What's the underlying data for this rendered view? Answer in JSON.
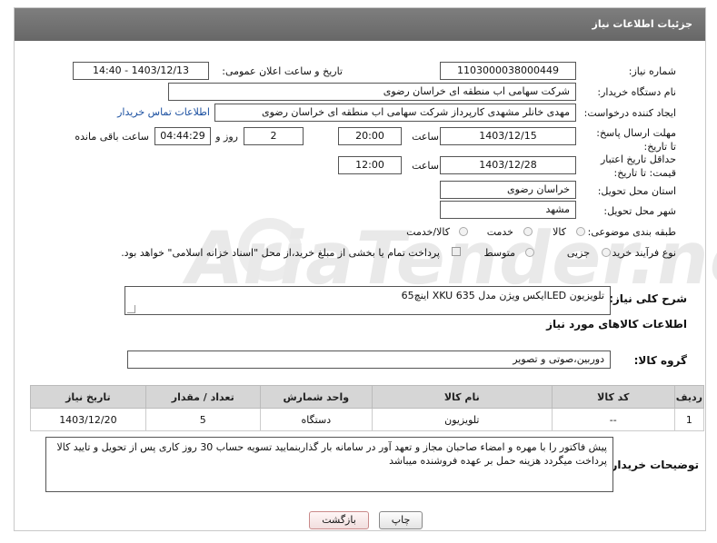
{
  "header": {
    "title": "جزئیات اطلاعات نیاز"
  },
  "labels": {
    "need_number": "شماره نیاز:",
    "announce_datetime": "تاریخ و ساعت اعلان عمومی:",
    "buyer_org": "نام دستگاه خریدار:",
    "requester": "ایجاد کننده درخواست:",
    "reply_deadline": "مهلت ارسال پاسخ: تا تاریخ:",
    "price_validity": "حداقل تاریخ اعتبار قیمت: تا تاریخ:",
    "time": "ساعت",
    "day_and": "روز و",
    "hours_remaining": "ساعت باقی مانده",
    "province": "استان محل تحویل:",
    "city": "شهر محل تحویل:",
    "category": "طبقه بندی موضوعی:",
    "process_type": "نوع فرآیند خرید :",
    "description": "شرح کلی نیاز:",
    "goods_info": "اطلاعات کالاهای مورد نیاز",
    "goods_group": "گروه کالا:",
    "buyer_notes": "توضیحات خریدار:"
  },
  "values": {
    "need_number": "1103000038000449",
    "announce_datetime": "1403/12/13 - 14:40",
    "buyer_org": "شرکت سهامی اب منطقه ای خراسان رضوی",
    "requester": "مهدی خانلر مشهدی کارپرداز شرکت سهامی اب منطقه ای خراسان رضوی",
    "contact_link": "اطلاعات تماس خریدار",
    "reply_date": "1403/12/15",
    "reply_time": "20:00",
    "days": "2",
    "remaining": "04:44:29",
    "validity_date": "1403/12/28",
    "validity_time": "12:00",
    "province": "خراسان رضوی",
    "city": "مشهد",
    "category_options": [
      "کالا",
      "خدمت",
      "کالا/خدمت"
    ],
    "process_options": [
      "جزیی",
      "متوسط"
    ],
    "payment_note": "پرداخت تمام یا بخشی از مبلغ خرید،از محل \"اسناد خزانه اسلامی\" خواهد بود.",
    "description": "تلویزیون LEDایکس ویژن مدل  XKU 635  اینچ65",
    "goods_group": "دوربین،صوتی و تصویر",
    "buyer_notes": "پیش فاکتور را با مهره و امضاء صاحبان مجاز و تعهد آور در سامانه بار گذاربنمایید  تسویه  حساب 30 روز کاری پس از تحویل و تایید کالا پرداخت میگردد هزینه حمل بر عهده فروشنده میباشد"
  },
  "table": {
    "headers": [
      "ردیف",
      "کد کالا",
      "نام کالا",
      "واحد شمارش",
      "تعداد / مقدار",
      "تاریخ نیاز"
    ],
    "rows": [
      [
        "1",
        "--",
        "تلویزیون",
        "دستگاه",
        "5",
        "1403/12/20"
      ]
    ]
  },
  "buttons": {
    "print": "چاپ",
    "back": "بازگشت"
  },
  "watermark": "AriaTender.neT",
  "colors": {
    "title_bar": "#727272",
    "link": "#1a4fa0",
    "back_button_border": "#c98a8a",
    "table_header": "#d6d6d6"
  }
}
